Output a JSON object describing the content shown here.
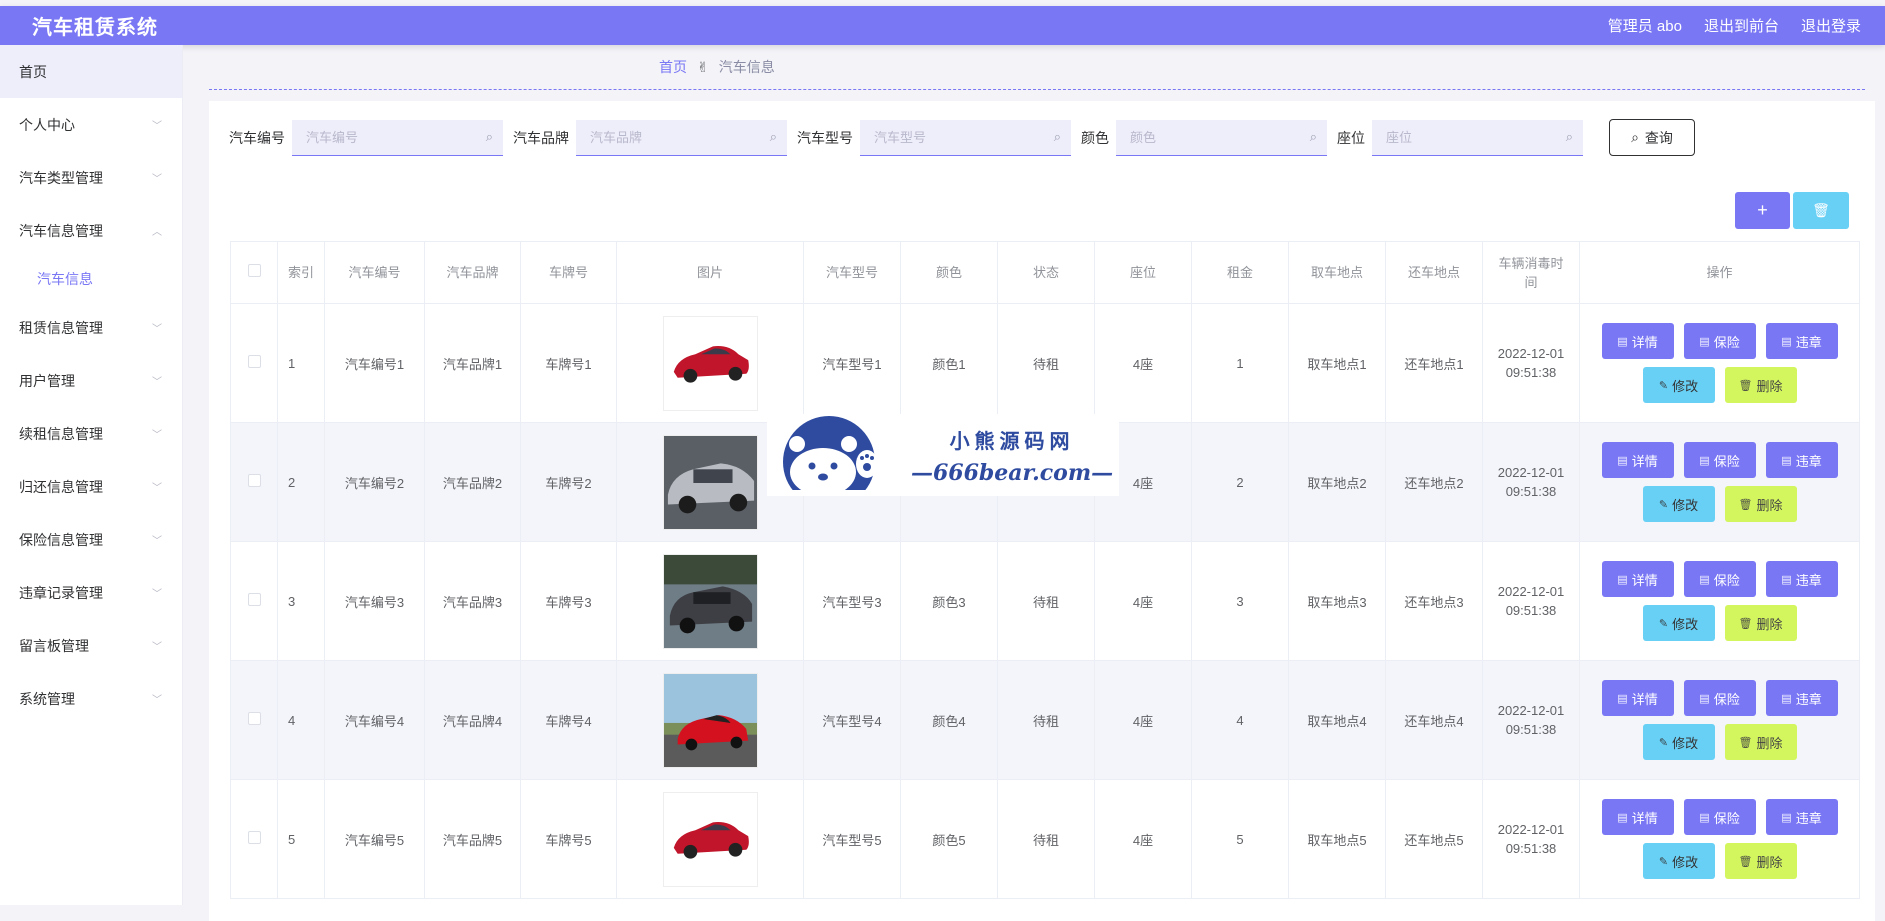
{
  "app": {
    "title": "汽车租赁系统"
  },
  "header": {
    "user": "管理员 abo",
    "to_front": "退出到前台",
    "logout": "退出登录"
  },
  "sidebar": {
    "items": [
      {
        "label": "首页"
      },
      {
        "label": "个人中心"
      },
      {
        "label": "汽车类型管理"
      },
      {
        "label": "汽车信息管理"
      },
      {
        "label": "租赁信息管理"
      },
      {
        "label": "用户管理"
      },
      {
        "label": "续租信息管理"
      },
      {
        "label": "归还信息管理"
      },
      {
        "label": "保险信息管理"
      },
      {
        "label": "违章记录管理"
      },
      {
        "label": "留言板管理"
      },
      {
        "label": "系统管理"
      }
    ],
    "subitem": "汽车信息"
  },
  "breadcrumb": {
    "home": "首页",
    "current": "汽车信息"
  },
  "search": {
    "fields": [
      {
        "label": "汽车编号",
        "placeholder": "汽车编号"
      },
      {
        "label": "汽车品牌",
        "placeholder": "汽车品牌"
      },
      {
        "label": "汽车型号",
        "placeholder": "汽车型号"
      },
      {
        "label": "颜色",
        "placeholder": "颜色"
      },
      {
        "label": "座位",
        "placeholder": "座位"
      }
    ],
    "query_label": "查询"
  },
  "toolbar": {
    "add": "+",
    "delete": "🗑"
  },
  "table": {
    "headers": [
      "索引",
      "汽车编号",
      "汽车品牌",
      "车牌号",
      "图片",
      "汽车型号",
      "颜色",
      "状态",
      "座位",
      "租金",
      "取车地点",
      "还车地点",
      "车辆消毒时间",
      "操作"
    ],
    "rows": [
      {
        "idx": "1",
        "code": "汽车编号1",
        "brand": "汽车品牌1",
        "plate": "车牌号1",
        "model": "汽车型号1",
        "color": "颜色1",
        "status": "待租",
        "seats": "4座",
        "rent": "1",
        "pickup": "取车地点1",
        "return": "还车地点1",
        "date": "2022-12-01",
        "time": "09:51:38"
      },
      {
        "idx": "2",
        "code": "汽车编号2",
        "brand": "汽车品牌2",
        "plate": "车牌号2",
        "model": "",
        "color": "",
        "status": "",
        "seats": "4座",
        "rent": "2",
        "pickup": "取车地点2",
        "return": "还车地点2",
        "date": "2022-12-01",
        "time": "09:51:38"
      },
      {
        "idx": "3",
        "code": "汽车编号3",
        "brand": "汽车品牌3",
        "plate": "车牌号3",
        "model": "汽车型号3",
        "color": "颜色3",
        "status": "待租",
        "seats": "4座",
        "rent": "3",
        "pickup": "取车地点3",
        "return": "还车地点3",
        "date": "2022-12-01",
        "time": "09:51:38"
      },
      {
        "idx": "4",
        "code": "汽车编号4",
        "brand": "汽车品牌4",
        "plate": "车牌号4",
        "model": "汽车型号4",
        "color": "颜色4",
        "status": "待租",
        "seats": "4座",
        "rent": "4",
        "pickup": "取车地点4",
        "return": "还车地点4",
        "date": "2022-12-01",
        "time": "09:51:38"
      },
      {
        "idx": "5",
        "code": "汽车编号5",
        "brand": "汽车品牌5",
        "plate": "车牌号5",
        "model": "汽车型号5",
        "color": "颜色5",
        "status": "待租",
        "seats": "4座",
        "rent": "5",
        "pickup": "取车地点5",
        "return": "还车地点5",
        "date": "2022-12-01",
        "time": "09:51:38"
      }
    ],
    "ops": {
      "detail": "详情",
      "insurance": "保险",
      "violation": "违章",
      "edit": "修改",
      "delete": "删除"
    }
  },
  "watermark": {
    "line1": "小熊源码网",
    "line2": "—666bear.com—"
  },
  "colors": {
    "primary": "#7a77f5",
    "cyan": "#69d0f5",
    "lime": "#d3f55e"
  }
}
